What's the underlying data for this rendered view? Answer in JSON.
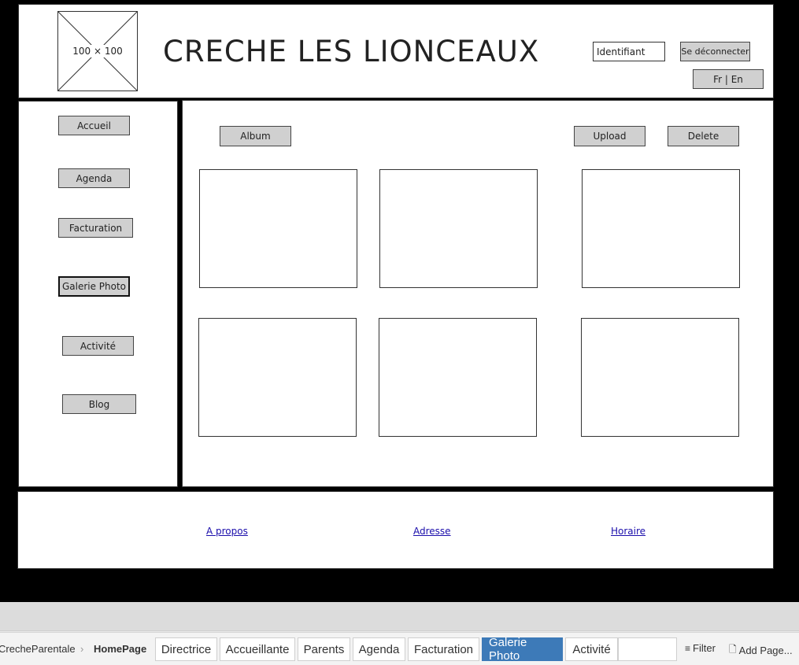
{
  "header": {
    "logo_placeholder": "100 × 100",
    "title": "CRECHE LES LIONCEAUX",
    "login_input_value": "Identifiant",
    "logout_label": "Se déconnecter",
    "language_label": "Fr | En"
  },
  "sidebar": {
    "items": [
      {
        "label": "Accueil"
      },
      {
        "label": "Agenda"
      },
      {
        "label": "Facturation"
      },
      {
        "label": "Galerie Photo"
      },
      {
        "label": "Activité"
      },
      {
        "label": "Blog"
      }
    ],
    "active": "Galerie Photo"
  },
  "main": {
    "album_label": "Album",
    "upload_label": "Upload",
    "delete_label": "Delete"
  },
  "footer": {
    "links": [
      "A propos",
      "Adresse",
      "Horaire"
    ]
  },
  "bottom_bar": {
    "breadcrumb": [
      "CrecheParentale",
      "HomePage"
    ],
    "tabs": [
      "Directrice",
      "Accueillante",
      "Parents",
      "Agenda",
      "Facturation",
      "Galerie Photo",
      "Activité"
    ],
    "selected_tab": "Galerie Photo",
    "filter_label": "Filter",
    "add_page_label": "Add Page..."
  },
  "colors": {
    "selected_tab": "#3d7ab8",
    "button_fill": "#d0d0d0",
    "link": "#1a0dab"
  }
}
